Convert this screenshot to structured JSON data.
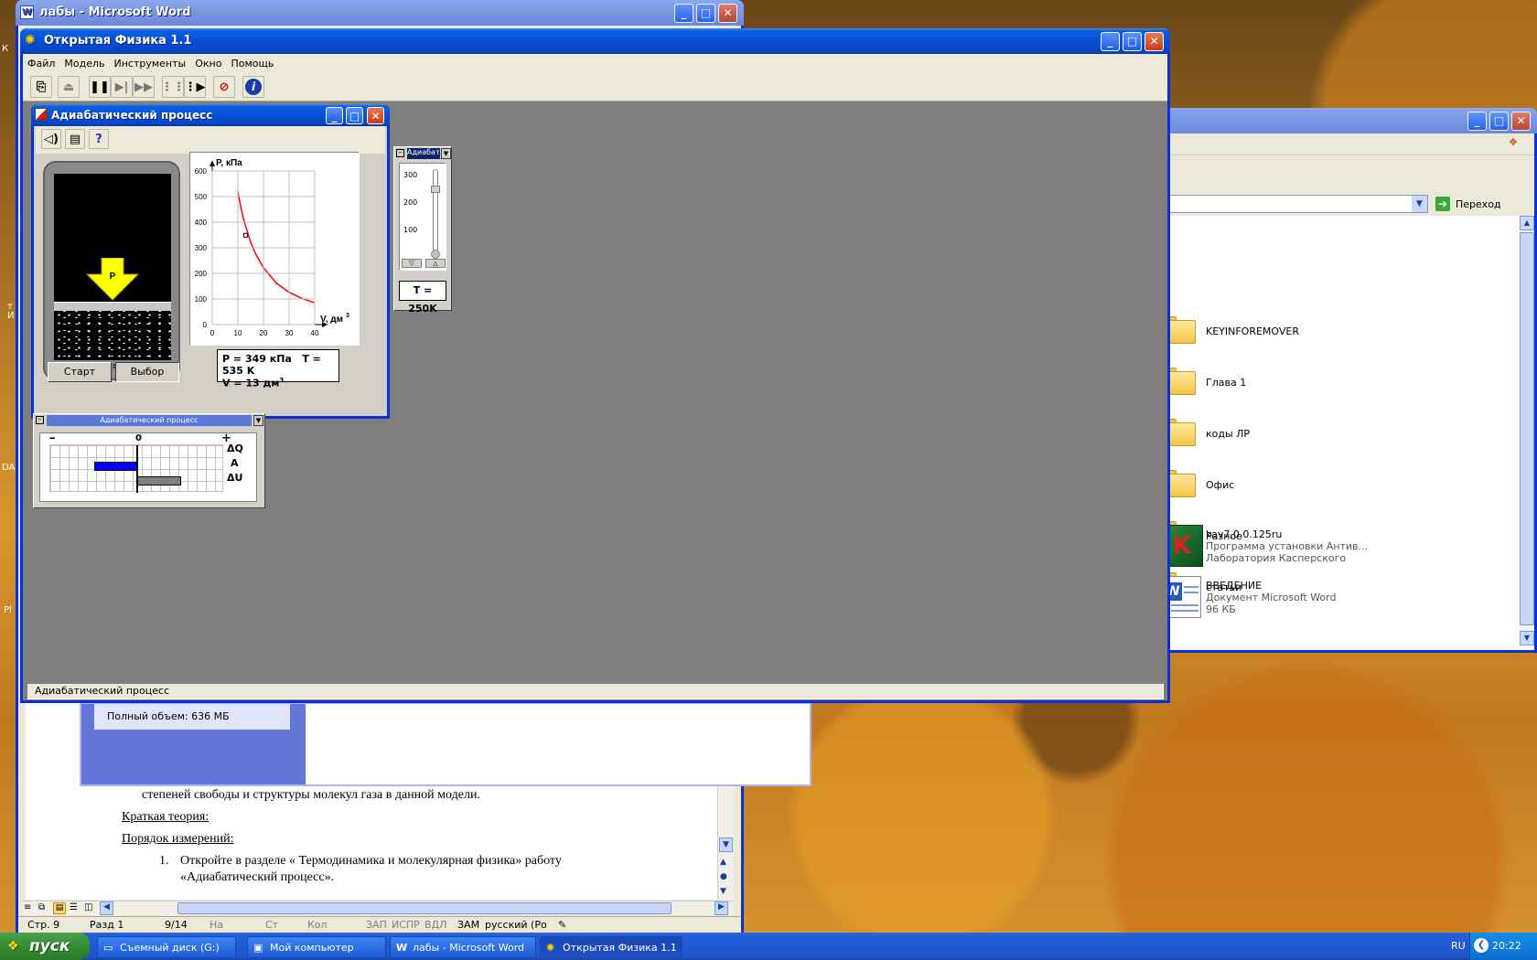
{
  "word": {
    "title": "лабы - Microsoft Word",
    "doc_lines": [
      "степеней свободы и структуры молекул газа в данной модели.",
      "Краткая теория:",
      "Порядок измерений:",
      "1.",
      "Откройте в  разделе  « Термодинамика и молекулярная физика» работу",
      "«Адиабатический  процесс»."
    ],
    "inner_panel": "Полный объем: 636 МБ",
    "status": {
      "page": "Стр. 9",
      "section": "Разд  1",
      "pages": "9/14",
      "at": "На",
      "ln": "Ст",
      "col": "Кол",
      "rec": "ЗАП",
      "trk": "ИСПР",
      "ext": "ВДЛ",
      "ovr": "ЗАМ",
      "lang": "русский (Ро"
    }
  },
  "explorer": {
    "go": "Переход",
    "items": [
      {
        "name": "KEYINFOREMOVER",
        "type": "folder"
      },
      {
        "name": "Глава 1",
        "type": "folder"
      },
      {
        "name": "коды ЛР",
        "type": "folder"
      },
      {
        "name": "Офис",
        "type": "folder"
      },
      {
        "name": "Разное",
        "type": "folder"
      },
      {
        "name": "статьи",
        "type": "folder"
      },
      {
        "name": "kav7.0.0.125ru",
        "type": "installer",
        "sub1": "Программа установки Антив...",
        "sub2": "Лаборатория Касперского"
      },
      {
        "name": "ВВЕДЕНИЕ",
        "type": "word",
        "sub1": "Документ Microsoft Word",
        "sub2": "96 КБ"
      }
    ],
    "partial": [
      "в",
      "t Word",
      "t Word"
    ]
  },
  "physics": {
    "title": "Открытая Физика 1.1",
    "menu": [
      "Файл",
      "Модель",
      "Инструменты",
      "Окно",
      "Помощь"
    ],
    "status": "Адиабатический процесс",
    "child": {
      "title": "Адиабатический процесс",
      "dq": "ΔQ = 0",
      "piston_label": "P",
      "start": "Старт",
      "choose": "Выбор",
      "readout": {
        "p": "P = 349 кПа",
        "t": "T = 535 K",
        "v": "V = 13 дм",
        "v_sup": "3"
      }
    },
    "thermo": {
      "title": "Адиабат",
      "ticks": [
        "300",
        "200",
        "100"
      ],
      "temp": "T = 250K",
      "value_k": 250
    },
    "energy": {
      "title": "Адиабатический процесс",
      "minus": "–",
      "zero": "0",
      "plus": "+",
      "labels": [
        "ΔQ",
        "A",
        "ΔU"
      ],
      "bars": [
        {
          "label": "A",
          "value": -0.5,
          "color": "#0000ff"
        },
        {
          "label": "ΔU",
          "value": 0.5,
          "color": "#808080"
        }
      ]
    }
  },
  "chart_data": {
    "type": "line",
    "title": "",
    "ylabel": "P, кПа",
    "xlabel": "V, дм",
    "xlabel_sup": "3",
    "xlim": [
      0,
      45
    ],
    "ylim": [
      0,
      640
    ],
    "xticks": [
      "0",
      "10",
      "20",
      "30",
      "40"
    ],
    "yticks": [
      "0",
      "100",
      "200",
      "300",
      "400",
      "500",
      "600"
    ],
    "series": [
      {
        "x": [
          10,
          11,
          12,
          13,
          15,
          17,
          20,
          25,
          30,
          35,
          40
        ],
        "y": [
          520,
          466,
          422,
          385,
          321,
          275,
          222,
          162,
          126,
          102,
          85
        ],
        "color": "#ff0000"
      }
    ],
    "marker": {
      "x": 13,
      "y": 349
    }
  },
  "taskbar": {
    "start": "пуск",
    "buttons": [
      "Съемный диск (G:)",
      "Мой компьютер",
      "лабы - Microsoft Word",
      "Открытая Физика 1.1"
    ],
    "lang": "RU",
    "clock": "20:22"
  },
  "desktop": {
    "left_labels": [
      "К",
      "т",
      "И",
      "DA",
      "Pl"
    ]
  }
}
